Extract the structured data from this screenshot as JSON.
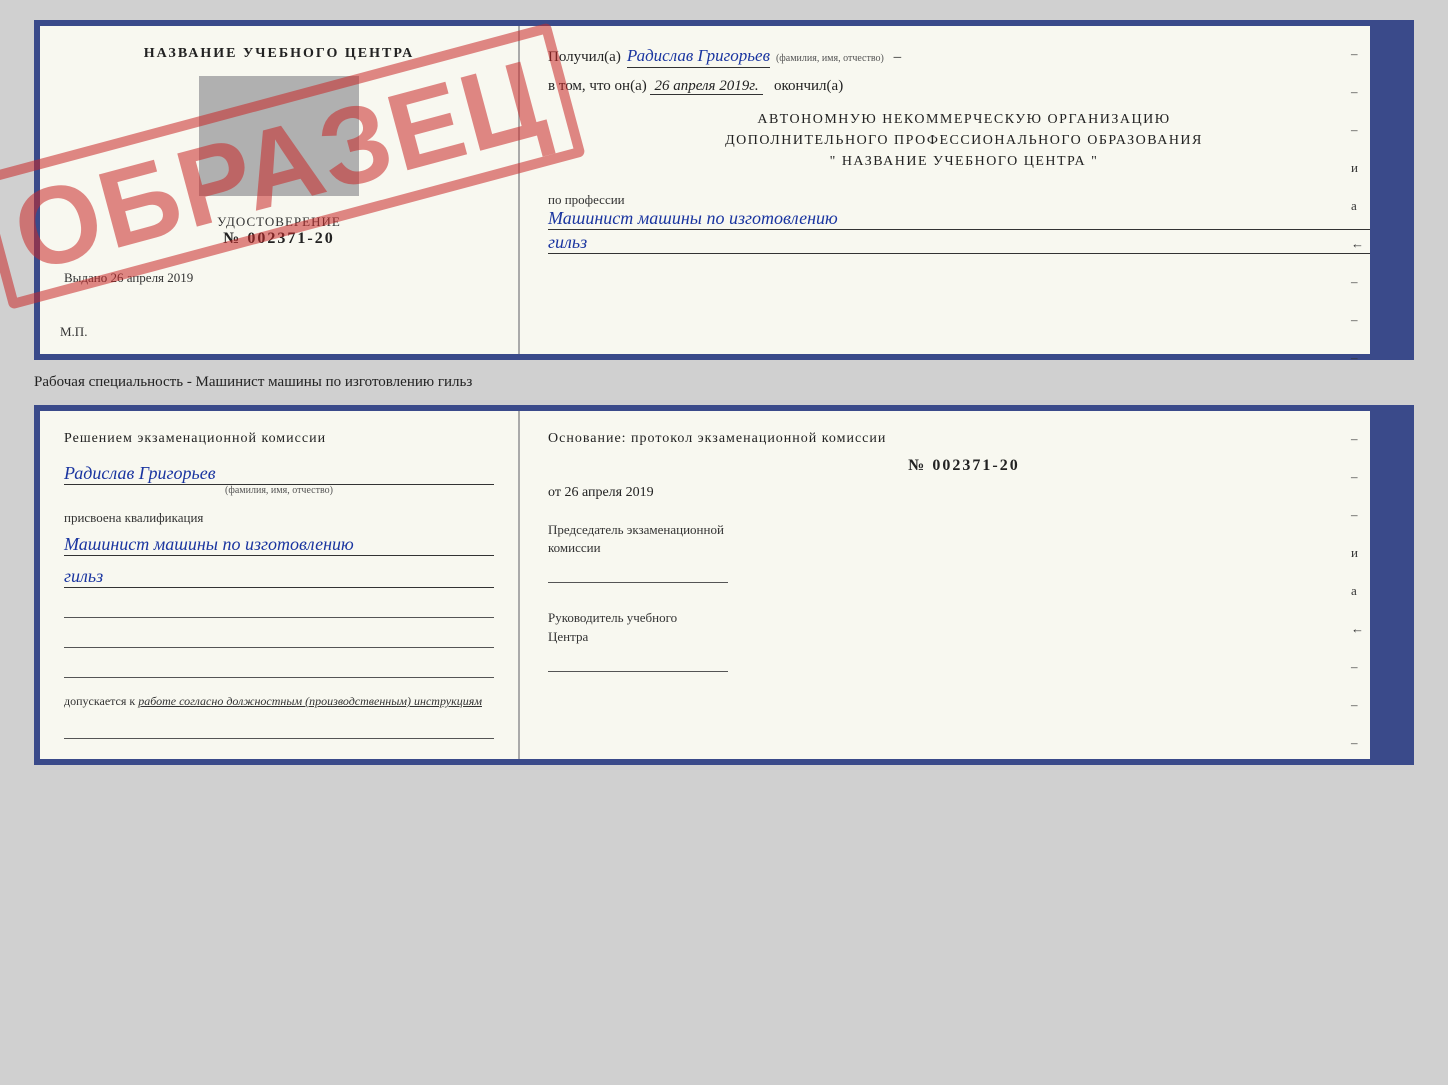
{
  "top_doc": {
    "left": {
      "center_title": "НАЗВАНИЕ УЧЕБНОГО ЦЕНТРА",
      "watermark": "ОБРАЗЕЦ",
      "udostoverenie": {
        "title": "УДОСТОВЕРЕНИЕ",
        "number": "№ 002371-20"
      },
      "vydano": "Выдано 26 апреля 2019",
      "mp": "М.П."
    },
    "right": {
      "recipient_prefix": "Получил(а)",
      "recipient_name": "Радислав Григорьев",
      "recipient_sublabel": "(фамилия, имя, отчество)",
      "date_prefix": "в том, что он(а)",
      "date_value": "26 апреля 2019г.",
      "date_suffix": "окончил(а)",
      "org_line1": "АВТОНОМНУЮ НЕКОММЕРЧЕСКУЮ ОРГАНИЗАЦИЮ",
      "org_line2": "ДОПОЛНИТЕЛЬНОГО ПРОФЕССИОНАЛЬНОГО ОБРАЗОВАНИЯ",
      "org_line3": "\"   НАЗВАНИЕ УЧЕБНОГО ЦЕНТРА   \"",
      "profession_label": "по профессии",
      "profession_value1": "Машинист машины по изготовлению",
      "profession_value2": "гильз",
      "side_dashes": [
        "–",
        "–",
        "–",
        "–",
        "–"
      ],
      "side_labels": [
        "и",
        "а",
        "←"
      ]
    }
  },
  "separator_label": "Рабочая специальность - Машинист машины по изготовлению гильз",
  "bottom_doc": {
    "left": {
      "commission_title": "Решением экзаменационной комиссии",
      "name": "Радислав Григорьев",
      "name_sublabel": "(фамилия, имя, отчество)",
      "assigned_label": "присвоена квалификация",
      "qualification_value1": "Машинист машины по изготовлению",
      "qualification_value2": "гильз",
      "blank_lines": [
        "",
        "",
        ""
      ],
      "dopusk_prefix": "допускается к",
      "dopusk_text": "работе согласно должностным (производственным) инструкциям"
    },
    "right": {
      "osnov_title": "Основание: протокол экзаменационной комиссии",
      "protocol_number": "№  002371-20",
      "protocol_date_prefix": "от",
      "protocol_date": "26 апреля 2019",
      "chairman_label1": "Председатель экзаменационной",
      "chairman_label2": "комиссии",
      "director_label1": "Руководитель учебного",
      "director_label2": "Центра",
      "side_dashes": [
        "–",
        "–",
        "–",
        "–",
        "–"
      ],
      "side_labels": [
        "и",
        "а",
        "←"
      ]
    }
  }
}
